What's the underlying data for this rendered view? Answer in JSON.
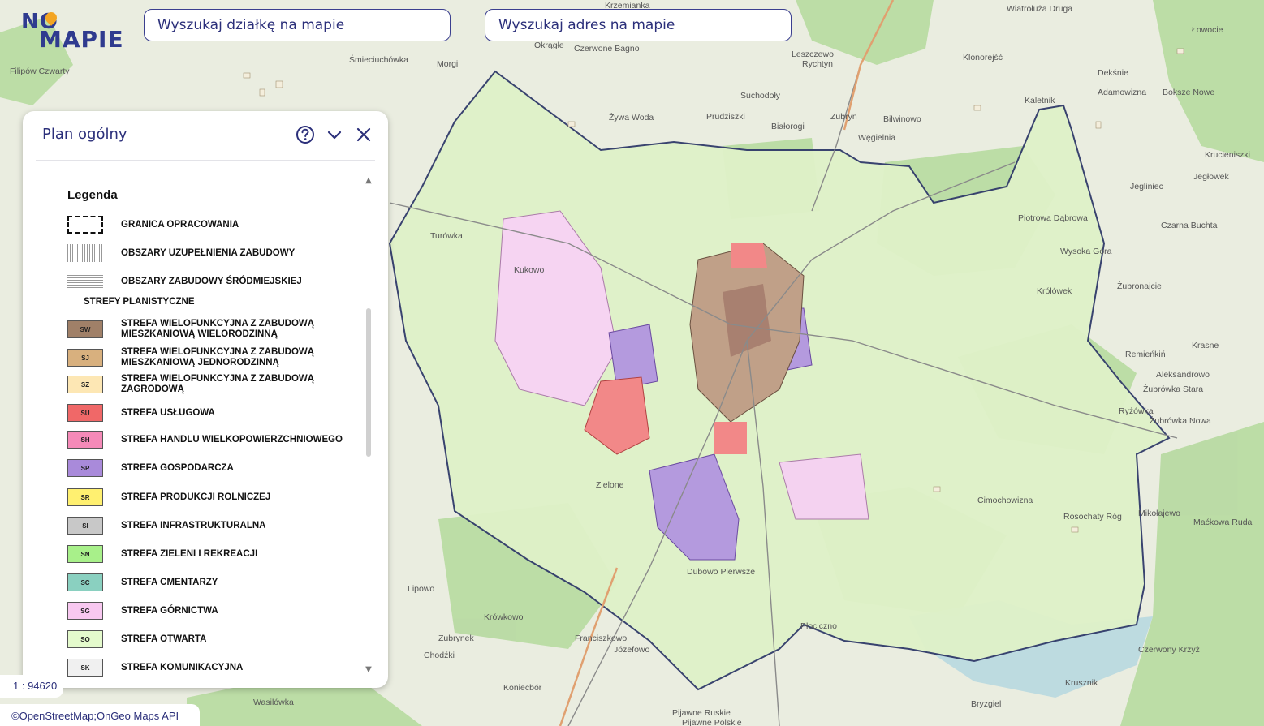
{
  "logo": {
    "line1": "NO",
    "line2": "MAPIE"
  },
  "search": {
    "parcel_placeholder": "Wyszukaj działkę na mapie",
    "address_placeholder": "Wyszukaj adres na mapie"
  },
  "panel": {
    "title": "Plan ogólny",
    "help_icon": "help-circle-icon",
    "collapse_icon": "chevron-down-icon",
    "close_icon": "close-icon"
  },
  "legend": {
    "title": "Legenda",
    "items": [
      {
        "code": "",
        "label": "GRANICA OPRACOWANIA",
        "style": "boundary"
      },
      {
        "code": "",
        "label": "OBSZARY UZUPEŁNIENIA ZABUDOWY",
        "style": "vlines"
      },
      {
        "code": "",
        "label": "OBSZARY ZABUDOWY ŚRÓDMIEJSKIEJ",
        "style": "hlines"
      },
      {
        "code": "",
        "label": "STREFY PLANISTYCZNE",
        "style": "header"
      },
      {
        "code": "SW",
        "label": "STREFA WIELOFUNKCYJNA Z ZABUDOWĄ MIESZKANIOWĄ WIELORODZINNĄ",
        "color": "#a08068"
      },
      {
        "code": "SJ",
        "label": "STREFA WIELOFUNKCYJNA Z ZABUDOWĄ MIESZKANIOWĄ JEDNORODZINNĄ",
        "color": "#d8b07e"
      },
      {
        "code": "SZ",
        "label": "STREFA WIELOFUNKCYJNA Z ZABUDOWĄ ZAGRODOWĄ",
        "color": "#fde7b4"
      },
      {
        "code": "SU",
        "label": "STREFA USŁUGOWA",
        "color": "#f06868"
      },
      {
        "code": "SH",
        "label": "STREFA HANDLU WIELKOPOWIERZCHNIOWEGO",
        "color": "#f58ab8"
      },
      {
        "code": "SP",
        "label": "STREFA GOSPODARCZA",
        "color": "#a98ada"
      },
      {
        "code": "SR",
        "label": "STREFA PRODUKCJI ROLNICZEJ",
        "color": "#fff070"
      },
      {
        "code": "SI",
        "label": "STREFA INFRASTRUKTURALNA",
        "color": "#c8c8c8"
      },
      {
        "code": "SN",
        "label": "STREFA ZIELENI I REKREACJI",
        "color": "#a8f08a"
      },
      {
        "code": "SC",
        "label": "STREFA CMENTARZY",
        "color": "#8ad0c0"
      },
      {
        "code": "SG",
        "label": "STREFA GÓRNICTWA",
        "color": "#f8c8f0"
      },
      {
        "code": "SO",
        "label": "STREFA OTWARTA",
        "color": "#e4facc"
      },
      {
        "code": "SK",
        "label": "STREFA KOMUNIKACYJNA",
        "color": "#f0f0f0"
      }
    ]
  },
  "scale": {
    "text": "1 : 94620"
  },
  "attribution": {
    "text": "©OpenStreetMap;OnGeo Maps API"
  },
  "map_labels": [
    "Krzemianka",
    "Wiatrołuża Druga",
    "Łowocie",
    "Śmieciuchówka",
    "Morgi",
    "Okrągłe",
    "Czerwone Bagno",
    "Leszczewo",
    "Rychtyn",
    "Klonorejść",
    "Dekśnie",
    "Adamowizna",
    "Bokszе Nowe",
    "Suchodoły",
    "Żywa Woda",
    "Prudziszki",
    "Białorogi",
    "Zubryn",
    "Bilwinowo",
    "Węgielnia",
    "Kaletnik",
    "Krucieniszki",
    "Jegłowek",
    "Jegliniec",
    "Czarna Buchta",
    "Piotrowa Dąbrowa",
    "Wysoka Góra",
    "Królówek",
    "Żubronajcie",
    "Krasne",
    "Remieńkiń",
    "Aleksandrowo",
    "Żubrówka Stara",
    "Ryżówka",
    "Żubrówka Nowa",
    "Mikołajewo",
    "Rosochaty Róg",
    "Maćkowa Ruda",
    "Cimochowizna",
    "Czerwony Krzyż",
    "Krusznik",
    "Bryzgiel",
    "Pijawne Ruskie",
    "Pijawne Polskie",
    "Wasilówka",
    "Koniecbór",
    "Franciszkowo",
    "Józefowo",
    "Zubrynek",
    "Chodźki",
    "Krówkowo",
    "Lipowo",
    "Zielone",
    "Filipów Czwarty",
    "Kukowo",
    "Turówka",
    "Dubowo Pierwsze",
    "Płociczno"
  ]
}
